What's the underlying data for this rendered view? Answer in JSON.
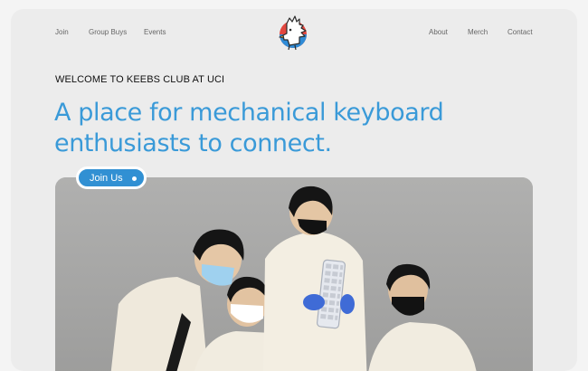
{
  "nav": {
    "left": [
      "Join",
      "Group Buys",
      "Events"
    ],
    "right": [
      "About",
      "Merch",
      "Contact"
    ]
  },
  "logo": {
    "icon": "rooster-mascot-logo-icon"
  },
  "hero": {
    "eyebrow": "WELCOME TO KEEBS CLUB AT UCI",
    "headline_line1": "A place for mechanical keyboard",
    "headline_line2": "enthusiasts to connect.",
    "cta_label": "Join Us"
  },
  "photo": {
    "subject": "group-photo"
  },
  "colors": {
    "accent": "#3a9ad8",
    "button": "#3190d3",
    "card": "#ececec",
    "mask_blue": "#9fd1ef"
  }
}
